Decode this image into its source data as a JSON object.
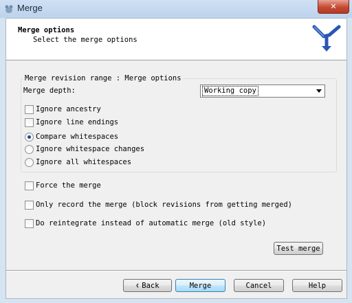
{
  "window": {
    "title": "Merge",
    "close_glyph": "✕"
  },
  "header": {
    "title": "Merge options",
    "subtitle": "Select the merge options",
    "logo_icon": "tortoisesvn-merge-logo"
  },
  "group": {
    "label": "Merge revision range : Merge options",
    "depth_label": "Merge depth:",
    "depth_value": "Working copy",
    "options": [
      {
        "label": "Ignore ancestry",
        "checked": false
      },
      {
        "label": "Ignore line endings",
        "checked": false
      }
    ],
    "whitespace": [
      {
        "label": "Compare whitespaces",
        "selected": true
      },
      {
        "label": "Ignore whitespace changes",
        "selected": false
      },
      {
        "label": "Ignore all whitespaces",
        "selected": false
      }
    ]
  },
  "extra_options": [
    {
      "label": "Force the merge",
      "checked": false
    },
    {
      "label": "Only record the merge (block revisions from getting merged)",
      "checked": false
    },
    {
      "label": "Do reintegrate instead of automatic merge (old style)",
      "checked": false
    }
  ],
  "test_merge_label": "Test merge",
  "buttons": {
    "back_glyph": "❮",
    "back": "Back",
    "merge": "Merge",
    "cancel": "Cancel",
    "help": "Help"
  }
}
